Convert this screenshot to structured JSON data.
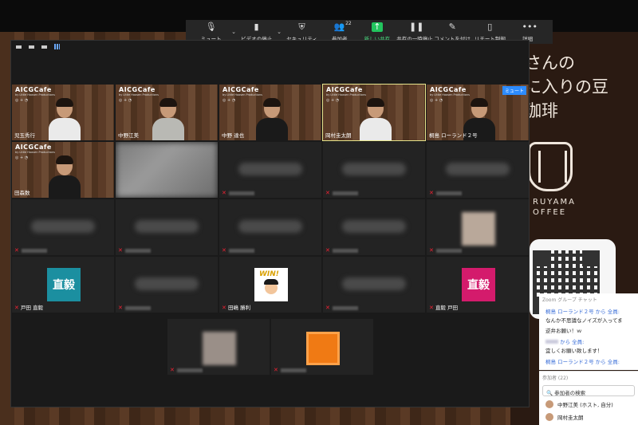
{
  "toolbar": {
    "items": [
      {
        "label": "ミュート",
        "icon": "microphone-icon"
      },
      {
        "label": "ビデオの停止",
        "icon": "video-camera-icon"
      },
      {
        "label": "セキュリティ",
        "icon": "shield-icon"
      },
      {
        "label": "参加者",
        "icon": "participants-icon",
        "count": "22"
      },
      {
        "label": "新しい共有",
        "icon": "share-arrow-icon"
      },
      {
        "label": "共有の一時停止",
        "icon": "pause-icon"
      },
      {
        "label": "コメントを付け",
        "icon": "pencil-icon"
      },
      {
        "label": "リモート制御",
        "icon": "mouse-icon"
      },
      {
        "label": "詳細",
        "icon": "more-dots-icon"
      }
    ],
    "share_color": "#22c55e"
  },
  "shared_screen": {
    "lines": [
      "さんの",
      "に入りの豆",
      "珈琲"
    ],
    "brand": "RUYAMA\nOFFEE"
  },
  "tiles": {
    "cafe_logo": "AICGCafe",
    "cafe_sub": "by Little Hoosen Productions",
    "t1": {
      "name": "児玉秀行"
    },
    "t2": {
      "name": "中野江美"
    },
    "t3": {
      "name": "中野 達也"
    },
    "t4": {
      "name": "岡村圭太朗"
    },
    "t5": {
      "name": "桐島 ローランド２号",
      "mute_tag": "ミュート"
    },
    "t6": {
      "name": "田森数"
    },
    "t7": {
      "name": "戸田 直毅",
      "kanji": "直毅",
      "color": "#1b8fa0"
    },
    "t8": {
      "name": "田嶋 勝利",
      "win": "WIN!"
    },
    "t9": {
      "name": "直毅 戸田",
      "kanji": "直毅",
      "color": "#d41b6c"
    }
  },
  "chat": {
    "header": "Zoom グループ チャット",
    "messages": [
      {
        "from": "桐島 ローランド２号 から 全員:",
        "text": "なんか不思議なノイズが入ってま"
      },
      {
        "from": "",
        "text": "逆弁お願い！ｗ"
      },
      {
        "from": "から 全員:",
        "text": "宜しくお願い致します！"
      },
      {
        "from": "桐島 ローランド２号 から 全員:",
        "text": ""
      }
    ]
  },
  "participants": {
    "header": "参加者 (22)",
    "search_placeholder": "参加者の検索",
    "rows": [
      {
        "name": "中野江美 (ホスト, 自分)"
      },
      {
        "name": "岡村圭太朗"
      }
    ]
  }
}
